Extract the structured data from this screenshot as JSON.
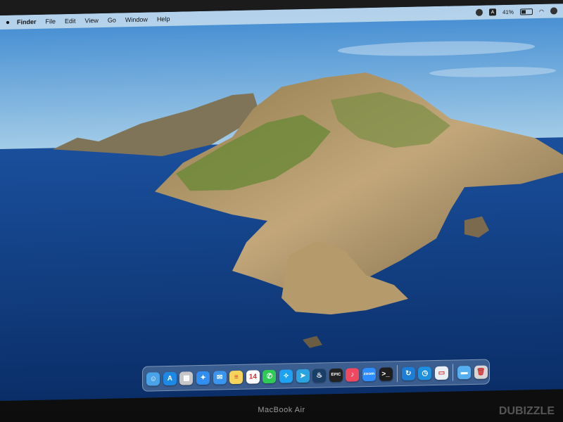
{
  "menubar": {
    "apple_icon": "apple-icon",
    "items": [
      "Finder",
      "File",
      "Edit",
      "View",
      "Go",
      "Window",
      "Help"
    ],
    "status": {
      "battery": "41%",
      "input_source": "A"
    }
  },
  "dock": {
    "apps": [
      {
        "name": "finder-icon",
        "color": "#4aa3e8",
        "glyph": "☺"
      },
      {
        "name": "app-store-icon",
        "color": "#1e88e5",
        "glyph": "A"
      },
      {
        "name": "launchpad-icon",
        "color": "#c6c6c6",
        "glyph": "▦"
      },
      {
        "name": "safari-icon",
        "color": "#2f8ef0",
        "glyph": "✦"
      },
      {
        "name": "mail-icon",
        "color": "#3a95f0",
        "glyph": "✉"
      },
      {
        "name": "notes-icon",
        "color": "#f6d45b",
        "glyph": "≡"
      },
      {
        "name": "calendar-icon",
        "color": "#ffffff",
        "glyph": "14"
      },
      {
        "name": "whatsapp-icon",
        "color": "#2ecc55",
        "glyph": "✆"
      },
      {
        "name": "twitter-icon",
        "color": "#1da1f2",
        "glyph": "✧"
      },
      {
        "name": "telegram-icon",
        "color": "#2aa3e0",
        "glyph": "➤"
      },
      {
        "name": "steam-icon",
        "color": "#1b3e66",
        "glyph": "♨"
      },
      {
        "name": "epic-games-icon",
        "color": "#222222",
        "glyph": "EPIC"
      },
      {
        "name": "music-icon",
        "color": "#f0485f",
        "glyph": "♪"
      },
      {
        "name": "zoom-icon",
        "color": "#2d8cff",
        "glyph": "zoom"
      },
      {
        "name": "terminal-icon",
        "color": "#1e1e1e",
        "glyph": ">_"
      }
    ],
    "extras": [
      {
        "name": "sync-icon",
        "color": "#1c7ed6",
        "glyph": "↻"
      },
      {
        "name": "time-machine-icon",
        "color": "#1f8fe0",
        "glyph": "◷"
      },
      {
        "name": "preview-icon",
        "color": "#e8eef4",
        "glyph": "▭"
      }
    ],
    "stack": [
      {
        "name": "downloads-folder-icon",
        "color": "#55aef0",
        "glyph": "▬"
      },
      {
        "name": "trash-icon",
        "color": "#d6d6d6",
        "glyph": "🗑"
      }
    ]
  },
  "device": {
    "label": "MacBook Air"
  },
  "watermark": {
    "label": "DUBIZZLE"
  },
  "colors": {
    "sky": "#5da3d9",
    "sea": "#0f3b7d",
    "rock": "#a98c5e",
    "vegetation": "#6e8a3a"
  }
}
